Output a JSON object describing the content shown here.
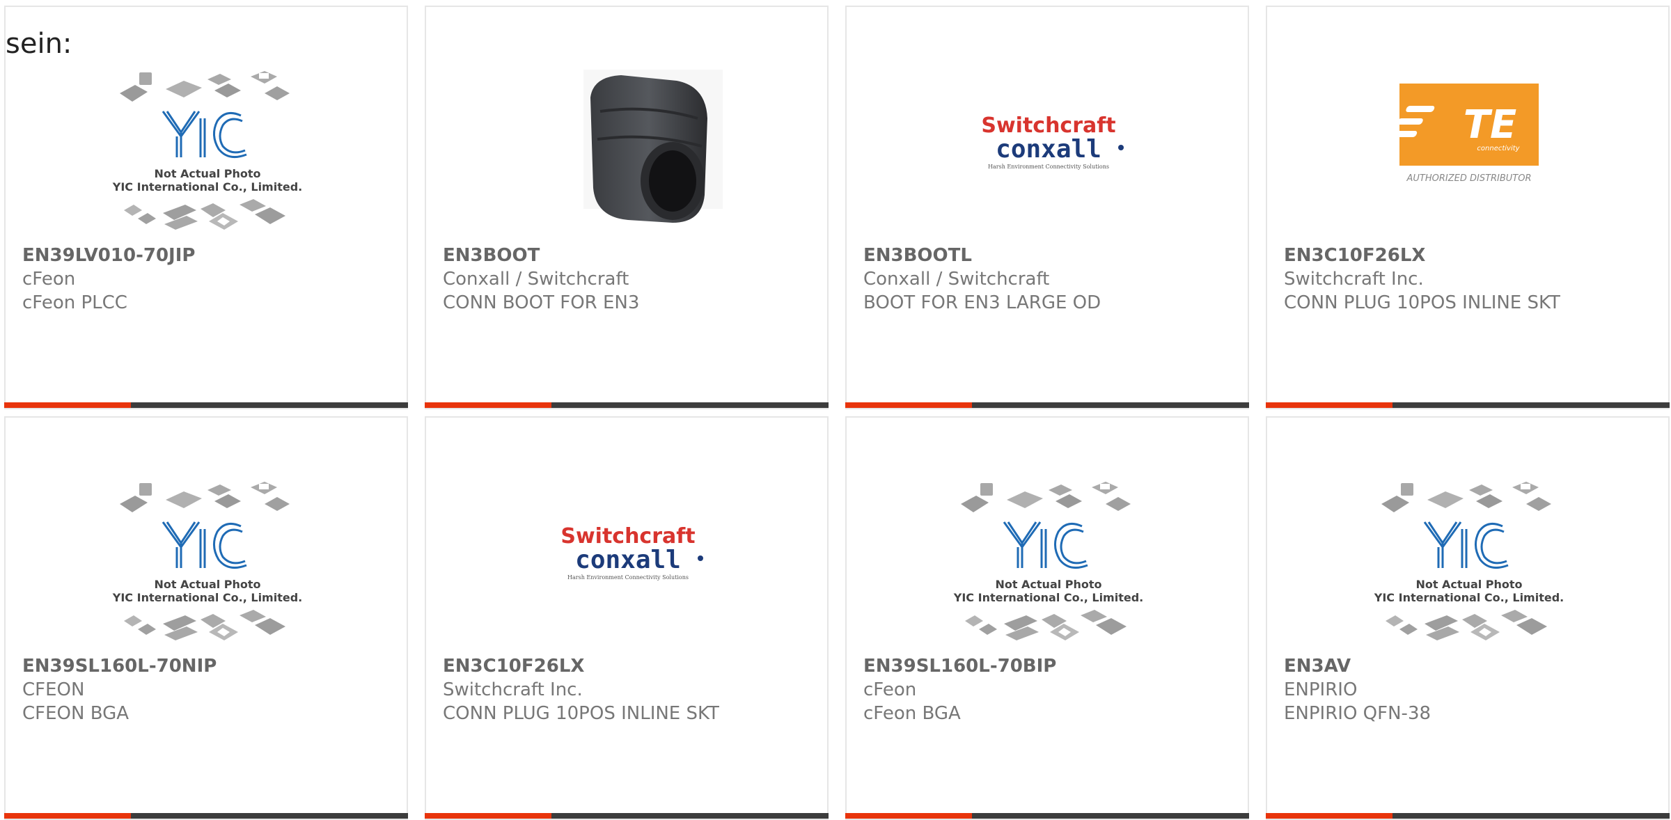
{
  "label": "sein:",
  "colors": {
    "accent": "#e8340c",
    "bar": "#3c3c3c",
    "yic_blue": "#1f6bb5",
    "te_orange": "#f39a27",
    "switchcraft_red": "#d8342e",
    "conxall_blue": "#1c3b7a"
  },
  "yic_logo": {
    "line1": "Not Actual Photo",
    "line2": "YIC International Co., Limited."
  },
  "switchcraft_logo": {
    "word1": "Switchcraft",
    "word2": "conxall",
    "tag": "Harsh Environment Connectivity Solutions"
  },
  "te_logo": {
    "word": "TE",
    "sub": "connectivity",
    "caption": "AUTHORIZED DISTRIBUTOR"
  },
  "products": [
    {
      "part": "EN39LV010-70JIP",
      "mfr": "cFeon",
      "desc": "cFeon PLCC",
      "image": "yic-placeholder"
    },
    {
      "part": "EN3BOOT",
      "mfr": "Conxall / Switchcraft",
      "desc": "CONN BOOT FOR EN3",
      "image": "rubber-boot-photo"
    },
    {
      "part": "EN3BOOTL",
      "mfr": "Conxall / Switchcraft",
      "desc": "BOOT FOR EN3 LARGE OD",
      "image": "switchcraft-logo"
    },
    {
      "part": "EN3C10F26LX",
      "mfr": "Switchcraft Inc.",
      "desc": "CONN PLUG 10POS INLINE SKT",
      "image": "te-logo"
    },
    {
      "part": "EN39SL160L-70NIP",
      "mfr": "CFEON",
      "desc": "CFEON BGA",
      "image": "yic-placeholder"
    },
    {
      "part": "EN3C10F26LX",
      "mfr": "Switchcraft Inc.",
      "desc": "CONN PLUG 10POS INLINE SKT",
      "image": "switchcraft-logo"
    },
    {
      "part": "EN39SL160L-70BIP",
      "mfr": "cFeon",
      "desc": "cFeon BGA",
      "image": "yic-placeholder"
    },
    {
      "part": "EN3AV",
      "mfr": "ENPIRIO",
      "desc": "ENPIRIO QFN-38",
      "image": "yic-placeholder"
    }
  ]
}
